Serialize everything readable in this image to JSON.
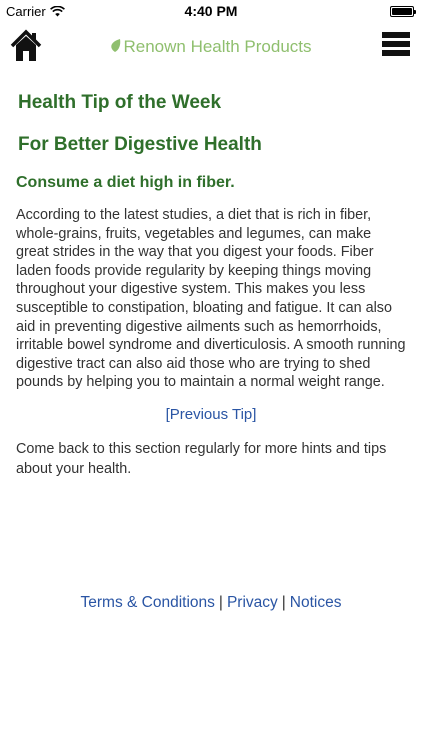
{
  "status_bar": {
    "carrier": "Carrier",
    "time": "4:40 PM"
  },
  "header": {
    "brand": "Renown Health Products",
    "brand_color": "#8fbf6e"
  },
  "content": {
    "section_title": "Health Tip of the Week",
    "tip_title": "For Better Digestive Health",
    "headline": "Consume a diet high in fiber.",
    "body": "According to the latest studies, a diet that is rich in fiber, whole-grains, fruits, vegetables and legumes, can make great strides in the way that you digest your foods. Fiber laden foods provide regularity by keeping things moving throughout your digestive system. This makes you less susceptible to constipation, bloating and fatigue. It can also aid in preventing digestive ailments such as hemorrhoids, irritable bowel syndrome and diverticulosis. A smooth running digestive tract can also aid those who are trying to shed pounds by helping you to maintain a normal weight range.",
    "previous_tip_label": "[Previous Tip]",
    "closing": "Come back to this section regularly for more hints and tips about your health.",
    "heading_color": "#2f6f2b",
    "link_color": "#2a55a4"
  },
  "footer": {
    "terms_label": "Terms & Conditions",
    "privacy_label": "Privacy",
    "notices_label": "Notices",
    "separator": "|"
  },
  "icons": {
    "home": "home-icon",
    "menu": "hamburger-menu-icon",
    "leaf": "leaf-icon",
    "wifi": "wifi-icon",
    "battery": "battery-icon"
  }
}
